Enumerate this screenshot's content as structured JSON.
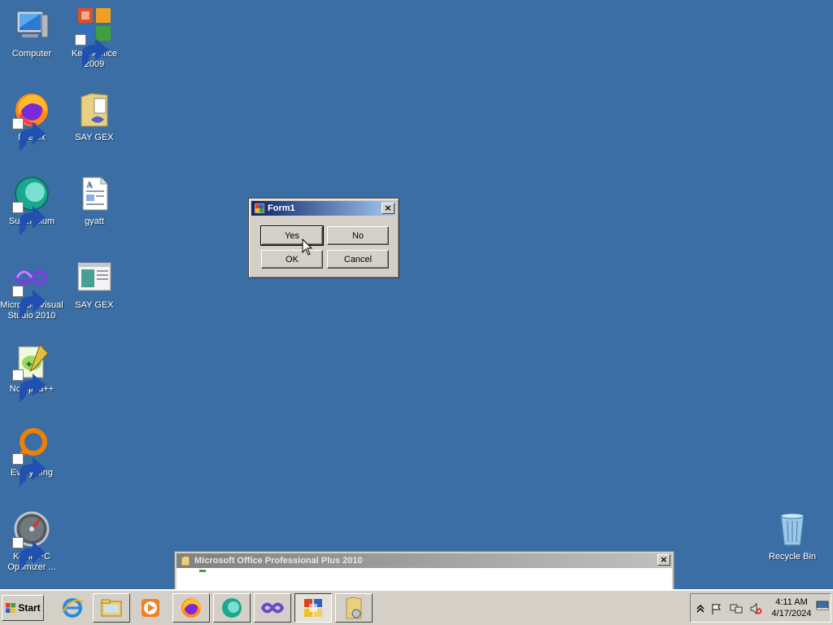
{
  "desktop": {
    "background_color": "#3a6ea5",
    "icons": [
      {
        "label": "Computer",
        "icon": "computer-icon"
      },
      {
        "label": "KevinOffice\n2009",
        "icon": "office-icon"
      },
      {
        "label": "Firefox",
        "icon": "firefox-icon"
      },
      {
        "label": "SAY GEX",
        "icon": "folder-icon"
      },
      {
        "label": "Supermium",
        "icon": "supermium-icon"
      },
      {
        "label": "gyatt",
        "icon": "document-icon"
      },
      {
        "label": "Microsoft Visual\nStudio 2010",
        "icon": "visual-studio-icon"
      },
      {
        "label": "SAY GEX",
        "icon": "window-app-icon"
      },
      {
        "label": "Notepad++",
        "icon": "notepad-plus-plus-icon"
      },
      {
        "label": "Everything",
        "icon": "everything-search-icon"
      },
      {
        "label": "Kevin PC\nOptimizer ...",
        "icon": "gauge-icon"
      },
      {
        "label": "Recycle Bin",
        "icon": "recycle-bin-icon"
      }
    ]
  },
  "form1": {
    "title": "Form1",
    "close_label": "×",
    "buttons": {
      "yes": "Yes",
      "no": "No",
      "ok": "OK",
      "cancel": "Cancel"
    }
  },
  "office_window": {
    "title": "Microsoft Office Professional Plus 2010",
    "close_label": "×"
  },
  "taskbar": {
    "start_label": "Start",
    "items": [
      "internet-explorer-icon",
      "file-explorer-icon",
      "media-player-icon",
      "firefox-icon",
      "supermium-icon",
      "visual-studio-icon",
      "office-installer-icon",
      "folder-icon"
    ],
    "clock_time": "4:11 AM",
    "clock_date": "4/17/2024"
  }
}
